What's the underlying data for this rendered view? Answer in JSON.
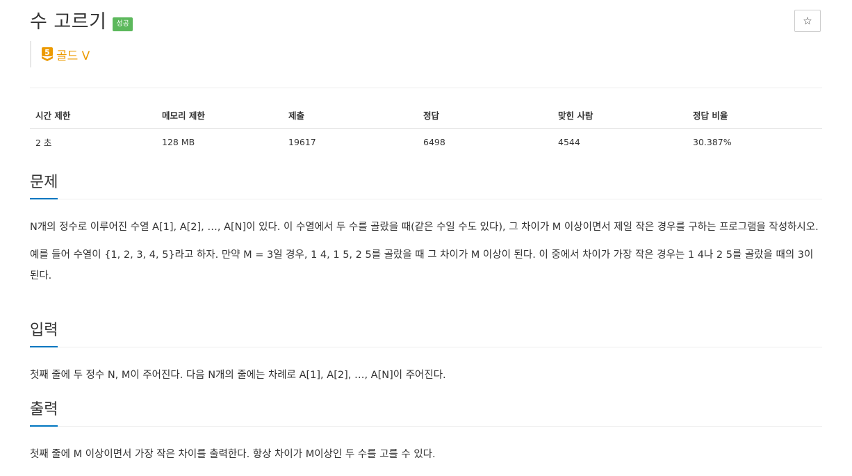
{
  "problem": {
    "title": "수 고르기",
    "status_badge": "성공",
    "star_icon": "☆"
  },
  "tier": {
    "level": "5",
    "label": "골드 V",
    "color": "#ec9a00"
  },
  "info_table": {
    "headers": [
      "시간 제한",
      "메모리 제한",
      "제출",
      "정답",
      "맞힌 사람",
      "정답 비율"
    ],
    "values": [
      "2 초",
      "128 MB",
      "19617",
      "6498",
      "4544",
      "30.387%"
    ]
  },
  "sections": {
    "description": {
      "heading": "문제",
      "paragraphs": [
        "N개의 정수로 이루어진 수열 A[1], A[2], …, A[N]이 있다. 이 수열에서 두 수를 골랐을 때(같은 수일 수도 있다), 그 차이가 M 이상이면서 제일 작은 경우를 구하는 프로그램을 작성하시오.",
        "예를 들어 수열이 {1, 2, 3, 4, 5}라고 하자. 만약 M = 3일 경우, 1 4, 1 5, 2 5를 골랐을 때 그 차이가 M 이상이 된다. 이 중에서 차이가 가장 작은 경우는 1 4나 2 5를 골랐을 때의 3이 된다."
      ]
    },
    "input": {
      "heading": "입력",
      "paragraphs": [
        "첫째 줄에 두 정수 N, M이 주어진다. 다음 N개의 줄에는 차례로 A[1], A[2], …, A[N]이 주어진다."
      ]
    },
    "output": {
      "heading": "출력",
      "paragraphs": [
        "첫째 줄에 M 이상이면서 가장 작은 차이를 출력한다. 항상 차이가 M이상인 두 수를 고를 수 있다."
      ]
    }
  },
  "colors": {
    "accent": "#0076c0",
    "success": "#5cb85c",
    "gold": "#ec9a00"
  }
}
